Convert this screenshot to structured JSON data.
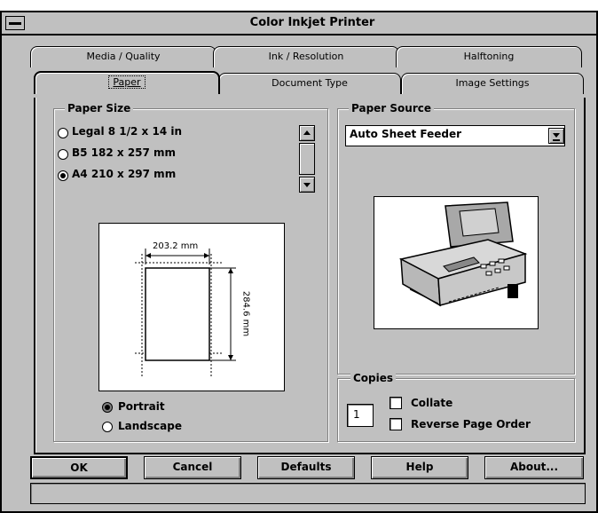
{
  "window": {
    "title": "Color Inkjet Printer"
  },
  "tabs_back": [
    {
      "label": "Media / Quality",
      "hotkey_index": 0
    },
    {
      "label": "Ink / Resolution",
      "hotkey_index": 6
    },
    {
      "label": "Halftoning",
      "hotkey_index": 3
    }
  ],
  "tabs_front": [
    {
      "label": "Paper",
      "active": true
    },
    {
      "label": "Document Type"
    },
    {
      "label": "Image Settings"
    }
  ],
  "paper_size": {
    "label": "Paper Size",
    "options": [
      {
        "label": "Legal 8 1/2 x 14 in",
        "selected": false
      },
      {
        "label": "B5 182 x 257 mm",
        "selected": false
      },
      {
        "label": "A4 210 x 297 mm",
        "selected": true
      }
    ],
    "preview": {
      "width_label": "203.2 mm",
      "height_label": "284.6 mm"
    }
  },
  "orientation": {
    "options": [
      {
        "label": "Portrait",
        "selected": true
      },
      {
        "label": "Landscape",
        "selected": false
      }
    ]
  },
  "paper_source": {
    "label": "Paper Source",
    "selected": "Auto Sheet Feeder",
    "image_icon": "printer-image"
  },
  "copies": {
    "label": "Copies",
    "value": "1",
    "collate_label": "Collate",
    "collate_checked": false,
    "reverse_label": "Reverse Page Order",
    "reverse_checked": false
  },
  "buttons": {
    "ok": "OK",
    "cancel": "Cancel",
    "defaults": "Defaults",
    "help": "Help",
    "about": "About..."
  },
  "colors": {
    "face": "#c0c0c0",
    "shadow": "#808080",
    "highlight": "#ffffff"
  }
}
